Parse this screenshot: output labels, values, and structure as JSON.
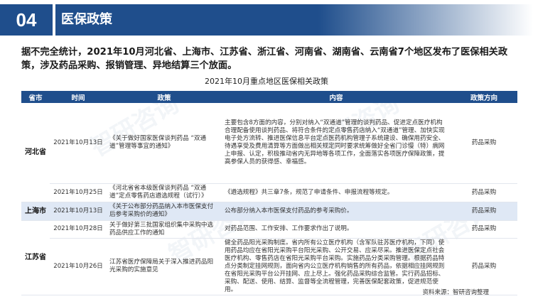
{
  "header": {
    "section_number": "04",
    "section_title": "医保政策"
  },
  "summary": "据不完全统计，2021年10月河北省、上海市、江苏省、浙江省、河南省、湖南省、云南省7个地区发布了医保相关政策，涉及药品采购、报销管理、异地结算三个放面。",
  "table": {
    "title": "2021年10月重点地区医保相关政策",
    "headers": {
      "province": "省市",
      "time": "时间",
      "policy": "政策",
      "content": "内容",
      "direction": "政策方向"
    },
    "rows": [
      {
        "province": "河北省",
        "time": "2021年10月13日",
        "policy": "《关于做好国家医保谈判药品 “双通道”管理等事宜的通知》",
        "content": "主要包含8方面的内容，分别对纳入“双通道”管理的谈判药品、促进定点医疗机构合理配备使用谈判药品、将符合条件的定点零售药店纳入“双通道”管理、加快实现电子处方流转、推进医保信息平台定点医药机构管理子系统建设、确保用药安全、待遇享受及费用清算等方面做出相关规定同时要求统筹做好全省门诊慢（特）病网上申报、认定，积极推动省内无异地等各项工作，全面落实各项医疗保障政策，提高参保人员的获得感、幸福感。",
        "direction": "药品采购"
      },
      {
        "province": "",
        "time": "2021年10月25日",
        "policy": "《河北省省本级医保谈判药品 “双通道”定点零售药店遴选规程（试行）》",
        "content": "《遴选规程》共三章7条，规范了申请条件、申报流程等规定。",
        "direction": "药品采购"
      },
      {
        "province": "上海市",
        "time": "2021年10月13日",
        "policy": "《关于公布部分药品纳入本市医保支付后参考采购价的通知》",
        "content": "公布部分纳入本市医保支付药品的参考采购价。",
        "direction": "药品采购"
      },
      {
        "province": "江苏省",
        "time": "2021年10月28日",
        "policy": "关于做好第三批国家组织集中采购中选药品供应工作的通知",
        "content": "对药品范围、工作安排、工作要求作出了说明。",
        "direction": "药品采购"
      },
      {
        "province": "",
        "time": "2021年10月26日",
        "policy": "江苏省医疗保障局关于深入推进药品阳光采购的实施意见",
        "content": "健全药品阳光采购制度。省内所有公立医疗机构（含军队驻苏医疗机构，下同）使用药品均应在省阳光采购平台阳光采购、公开交易、应采尽采。推进医保定点社会医疗机构、零售药店在省阳光采购平台采购。实施药品分类采购管理。根据药品特点分类制定挂网规则，面向省内公立医疗机构销售的所有药品，依据相应挂网规则在省阳光采购平台公开挂网、应上尽上。强化药品采购综合监管。实行药品招标、采购、配送、使用、结算、监督等全流程管理，完善医保配套政策，促进规范使用。",
        "direction": "药品采购"
      }
    ]
  },
  "source_note": "资料来源：智研咨询整理",
  "watermark_text": "智研咨询",
  "colors": {
    "primary": "#1f4e8c",
    "row_highlight": "#dfe8f5"
  }
}
